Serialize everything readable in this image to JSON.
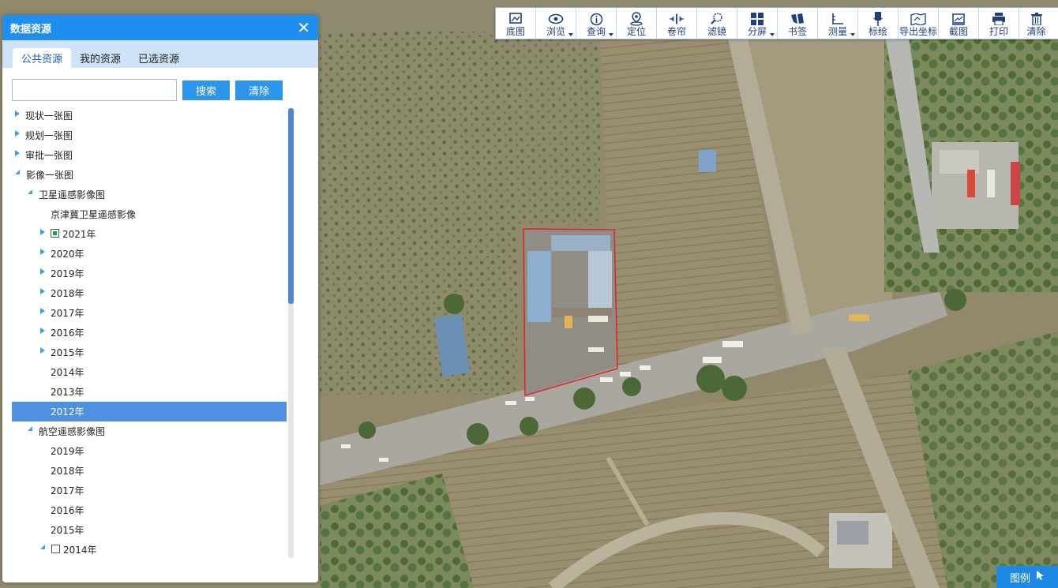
{
  "toolbar": {
    "items": [
      {
        "label": "底图",
        "icon": "basemap-icon"
      },
      {
        "label": "浏览",
        "icon": "eye-icon",
        "dropdown": true
      },
      {
        "label": "查询",
        "icon": "info-icon",
        "dropdown": true
      },
      {
        "label": "定位",
        "icon": "location-pin-icon"
      },
      {
        "label": "卷帘",
        "icon": "swipe-icon"
      },
      {
        "label": "滤镜",
        "icon": "magnifier-icon"
      },
      {
        "label": "分屏",
        "icon": "split-screen-icon",
        "dropdown": true
      },
      {
        "label": "书签",
        "icon": "bookmark-icon"
      },
      {
        "label": "测量",
        "icon": "ruler-icon",
        "dropdown": true
      },
      {
        "label": "标绘",
        "icon": "pushpin-icon"
      },
      {
        "label": "导出坐标",
        "icon": "export-map-icon"
      },
      {
        "label": "截图",
        "icon": "screenshot-icon"
      },
      {
        "label": "打印",
        "icon": "printer-icon"
      },
      {
        "label": "清除",
        "icon": "trash-icon"
      }
    ]
  },
  "legend": {
    "label": "图例",
    "icon": "cursor-arrow-icon"
  },
  "panel": {
    "title": "数据资源",
    "close_icon": "close-icon",
    "tabs": [
      "公共资源",
      "我的资源",
      "已选资源"
    ],
    "active_tab": 0,
    "search": {
      "value": "",
      "placeholder": ""
    },
    "search_button": "搜索",
    "clear_button": "清除",
    "tree": [
      {
        "label": "现状一张图",
        "level": 0,
        "toggle": "collapsed"
      },
      {
        "label": "规划一张图",
        "level": 0,
        "toggle": "collapsed"
      },
      {
        "label": "审批一张图",
        "level": 0,
        "toggle": "collapsed"
      },
      {
        "label": "影像一张图",
        "level": 0,
        "toggle": "expanded"
      },
      {
        "label": "卫星遥感影像图",
        "level": 1,
        "toggle": "expanded"
      },
      {
        "label": "京津冀卫星遥感影像",
        "level": 2,
        "toggle": "none"
      },
      {
        "label": "2021年",
        "level": 2,
        "toggle": "collapsed",
        "checkbox": "checked"
      },
      {
        "label": "2020年",
        "level": 2,
        "toggle": "collapsed"
      },
      {
        "label": "2019年",
        "level": 2,
        "toggle": "collapsed"
      },
      {
        "label": "2018年",
        "level": 2,
        "toggle": "collapsed"
      },
      {
        "label": "2017年",
        "level": 2,
        "toggle": "collapsed"
      },
      {
        "label": "2016年",
        "level": 2,
        "toggle": "collapsed"
      },
      {
        "label": "2015年",
        "level": 2,
        "toggle": "collapsed"
      },
      {
        "label": "2014年",
        "level": 2,
        "toggle": "none"
      },
      {
        "label": "2013年",
        "level": 2,
        "toggle": "none"
      },
      {
        "label": "2012年",
        "level": 2,
        "toggle": "none",
        "selected": true
      },
      {
        "label": "航空遥感影像图",
        "level": 1,
        "toggle": "expanded"
      },
      {
        "label": "2019年",
        "level": 2,
        "toggle": "none"
      },
      {
        "label": "2018年",
        "level": 2,
        "toggle": "none"
      },
      {
        "label": "2017年",
        "level": 2,
        "toggle": "none"
      },
      {
        "label": "2016年",
        "level": 2,
        "toggle": "none"
      },
      {
        "label": "2015年",
        "level": 2,
        "toggle": "none"
      },
      {
        "label": "2014年",
        "level": 2,
        "toggle": "expanded",
        "checkbox": "unchecked"
      }
    ]
  },
  "colors": {
    "panel_header": "#1f8ef1",
    "tab_bar": "#cfe3f8",
    "button": "#2d95ea",
    "selected_row": "#4f90e0",
    "parcel_outline": "#e0202a"
  }
}
